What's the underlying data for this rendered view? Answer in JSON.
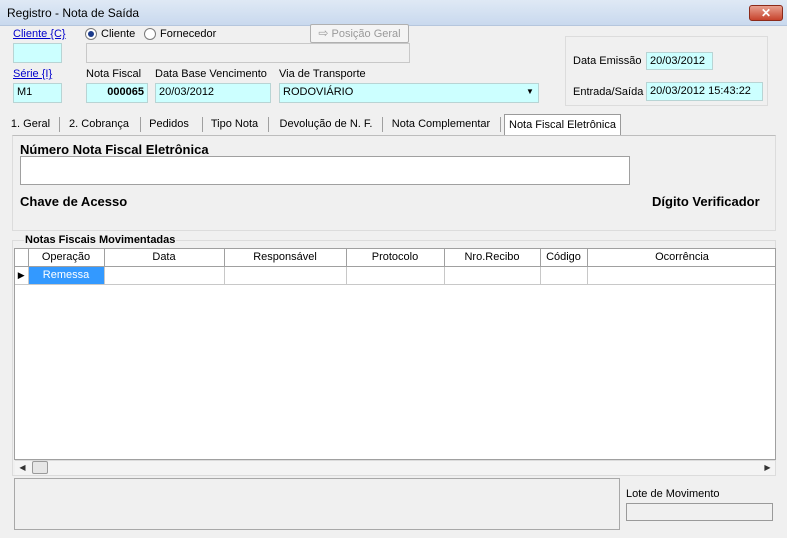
{
  "window": {
    "title": "Registro - Nota de Saída",
    "close_label": "✕"
  },
  "header": {
    "cliente_link": "Cliente {C}",
    "radio_cliente": "Cliente",
    "radio_fornecedor": "Fornecedor",
    "posicao_geral": "Posição Geral",
    "cliente_value": "",
    "cliente_name": "",
    "serie_link": "Série {I}",
    "serie_value": "M1",
    "nota_fiscal_label": "Nota Fiscal",
    "nota_fiscal_value": "000065",
    "data_base_label": "Data Base Vencimento",
    "data_base_value": "20/03/2012",
    "via_label": "Via de Transporte",
    "via_value": "RODOVIÁRIO",
    "data_emissao_label": "Data Emissão",
    "data_emissao_value": "20/03/2012",
    "entrada_label": "Entrada/Saída",
    "entrada_value": "20/03/2012 15:43:22"
  },
  "tabs": [
    {
      "label": "1. Geral"
    },
    {
      "label": "2. Cobrança"
    },
    {
      "label": "Pedidos"
    },
    {
      "label": "Tipo Nota"
    },
    {
      "label": "Devolução de N. F."
    },
    {
      "label": "Nota Complementar"
    },
    {
      "label": "Nota Fiscal Eletrônica"
    }
  ],
  "nfe": {
    "numero_label": "Número Nota Fiscal Eletrônica",
    "numero_value": "",
    "chave_label": "Chave de Acesso",
    "digito_label": "Dígito Verificador"
  },
  "grid": {
    "title": "Notas Fiscais Movimentadas",
    "columns": [
      "Operação",
      "Data",
      "Responsável",
      "Protocolo",
      "Nro.Recibo",
      "Código",
      "Ocorrência"
    ],
    "rows": [
      [
        "Remessa",
        "",
        "",
        "",
        "",
        "",
        ""
      ]
    ]
  },
  "footer": {
    "lote_label": "Lote de Movimento",
    "lote_value": ""
  },
  "colors": {
    "field_bg": "#ccffff",
    "selection": "#3399ff",
    "link": "#0000cc"
  }
}
